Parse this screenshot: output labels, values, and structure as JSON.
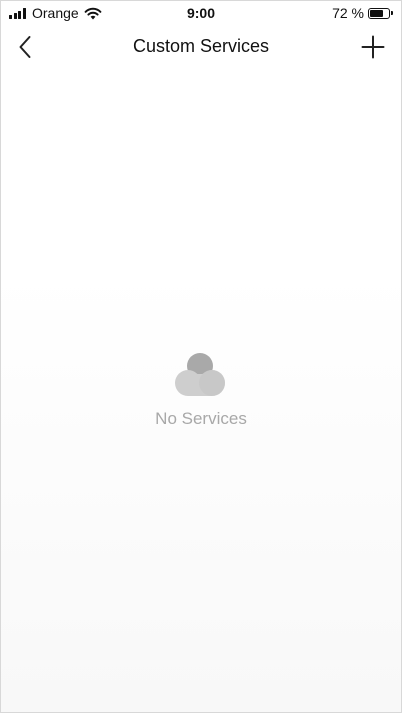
{
  "status_bar": {
    "carrier": "Orange",
    "time": "9:00",
    "battery_text": "72 %",
    "battery_level": 0.72
  },
  "nav": {
    "title": "Custom Services",
    "back_icon": "chevron-left-icon",
    "add_icon": "plus-icon"
  },
  "empty_state": {
    "icon": "cloud-icon",
    "label": "No Services"
  }
}
